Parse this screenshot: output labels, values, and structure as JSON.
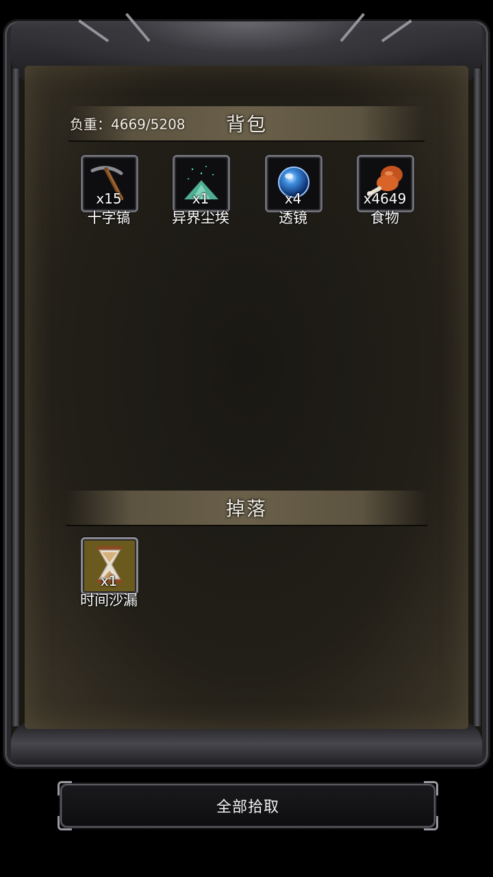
{
  "backpack": {
    "title": "背包",
    "weight_text": "负重：4669/5208",
    "items": [
      {
        "icon": "pickaxe-icon",
        "count": "x15",
        "name": "十字镐"
      },
      {
        "icon": "dust-pile-icon",
        "count": "x1",
        "name": "异界尘埃"
      },
      {
        "icon": "lens-orb-icon",
        "count": "x4",
        "name": "透镜"
      },
      {
        "icon": "meat-drumstick-icon",
        "count": "x4649",
        "name": "食物"
      }
    ]
  },
  "drops": {
    "title": "掉落",
    "items": [
      {
        "icon": "hourglass-icon",
        "count": "x1",
        "name": "时间沙漏",
        "highlight_color": "#6b5a1e"
      }
    ]
  },
  "actions": {
    "pick_all_label": "全部拾取"
  }
}
